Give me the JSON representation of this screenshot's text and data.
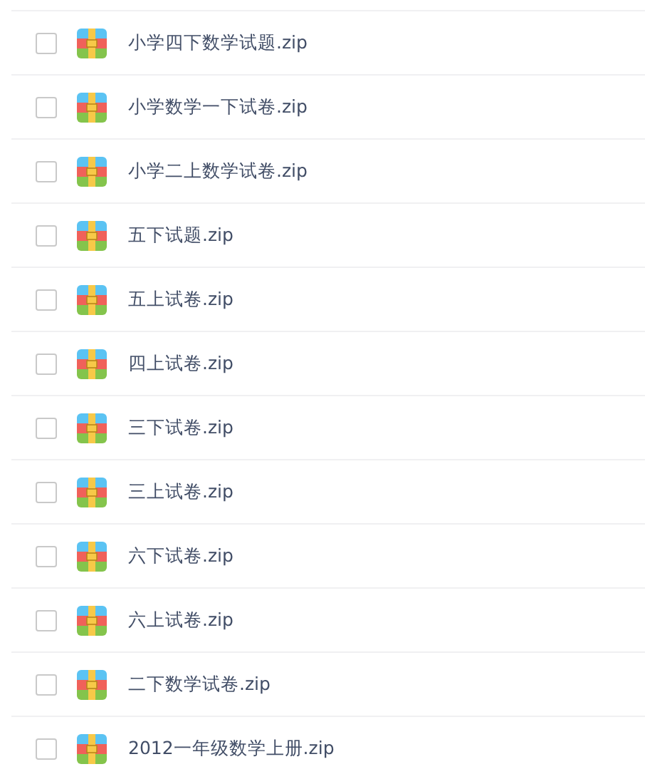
{
  "files": [
    {
      "name": "小学四下数学试题.zip",
      "checked": false
    },
    {
      "name": "小学数学一下试卷.zip",
      "checked": false
    },
    {
      "name": "小学二上数学试卷.zip",
      "checked": false
    },
    {
      "name": "五下试题.zip",
      "checked": false
    },
    {
      "name": "五上试卷.zip",
      "checked": false
    },
    {
      "name": "四上试卷.zip",
      "checked": false
    },
    {
      "name": "三下试卷.zip",
      "checked": false
    },
    {
      "name": "三上试卷.zip",
      "checked": false
    },
    {
      "name": "六下试卷.zip",
      "checked": false
    },
    {
      "name": "六上试卷.zip",
      "checked": false
    },
    {
      "name": "二下数学试卷.zip",
      "checked": false
    },
    {
      "name": "2012一年级数学上册.zip",
      "checked": false
    }
  ]
}
